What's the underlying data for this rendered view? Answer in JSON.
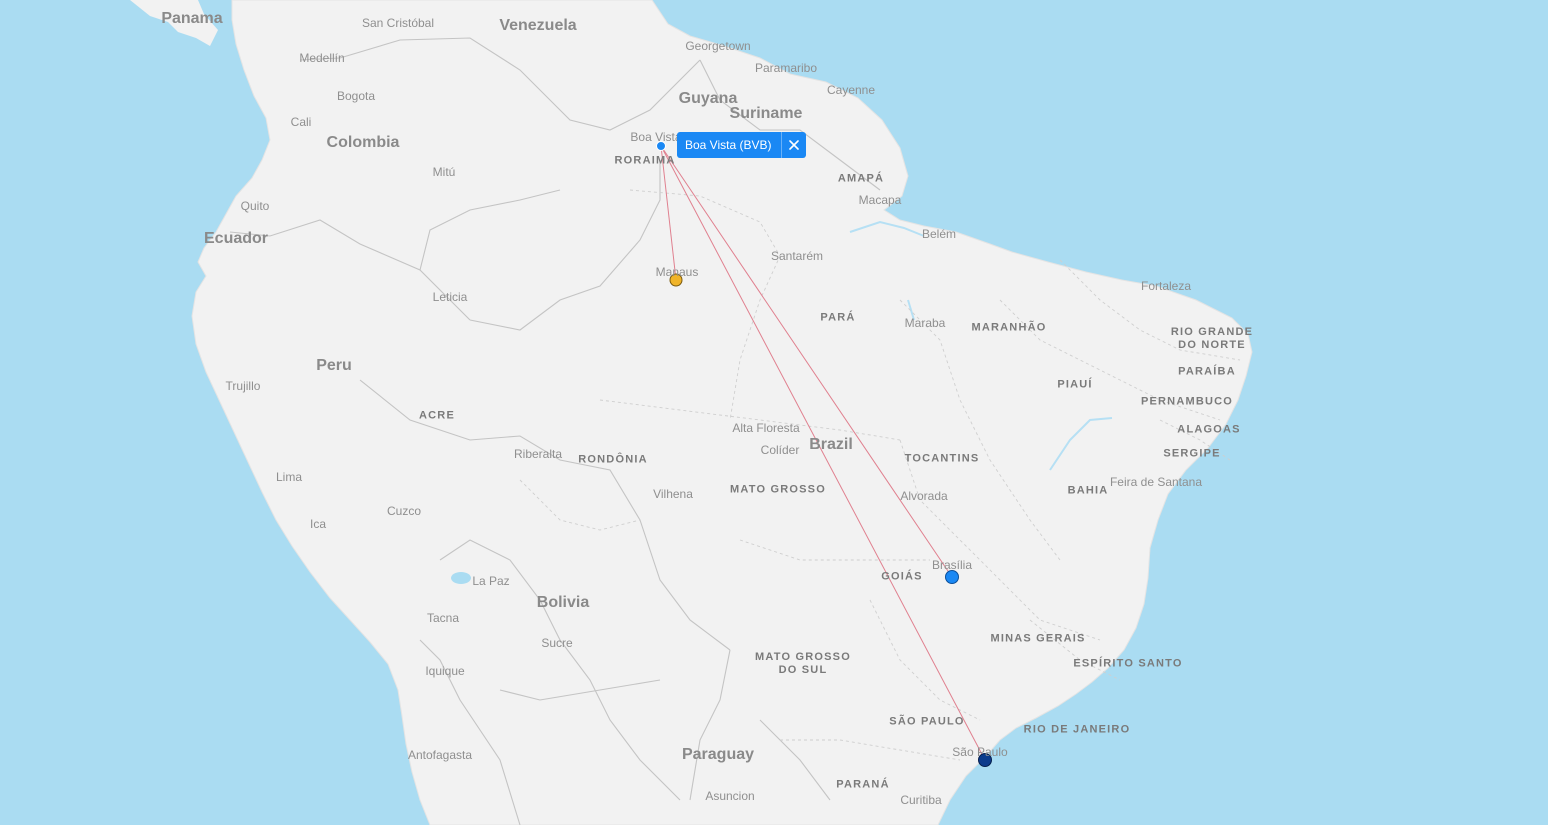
{
  "map": {
    "countries": {
      "panama": "Panama",
      "venezuela": "Venezuela",
      "guyana": "Guyana",
      "suriname": "Suriname",
      "colombia": "Colombia",
      "ecuador": "Ecuador",
      "peru": "Peru",
      "brazil": "Brazil",
      "bolivia": "Bolivia",
      "paraguay": "Paraguay"
    },
    "states": {
      "roraima": "RORAIMA",
      "amapa": "AMAPÁ",
      "para": "PARÁ",
      "maranhao": "MARANHÃO",
      "rio_grande_do_norte": "RIO GRANDE\nDO NORTE",
      "paraiba": "PARAÍBA",
      "piaui": "PIAUÍ",
      "pernambuco": "PERNAMBUCO",
      "alagoas": "ALAGOAS",
      "sergipe": "SERGIPE",
      "acre": "ACRE",
      "rondonia": "RONDÔNIA",
      "mato_grosso": "MATO GROSSO",
      "tocantins": "TOCANTINS",
      "bahia": "BAHIA",
      "goias": "GOIÁS",
      "minas_gerais": "MINAS GERAIS",
      "espirito_santo": "ESPÍRITO SANTO",
      "mato_grosso_do_sul": "MATO GROSSO\nDO SUL",
      "sao_paulo_state": "SÃO PAULO",
      "rio_de_janeiro": "RIO DE JANEIRO",
      "parana": "PARANÁ"
    },
    "cities": {
      "san_cristobal": "San Cristóbal",
      "georgetown": "Georgetown",
      "paramaribo": "Paramaribo",
      "cayenne": "Cayenne",
      "medellin": "Medellín",
      "bogota": "Bogota",
      "cali": "Cali",
      "boa_vista": "Boa Vista",
      "mitu": "Mitú",
      "macapa": "Macapa",
      "quito": "Quito",
      "belem": "Belém",
      "manaus": "Manaus",
      "santarem": "Santarém",
      "fortaleza": "Fortaleza",
      "leticia": "Leticia",
      "maraba": "Maraba",
      "trujillo": "Trujillo",
      "alta_floresta": "Alta Floresta",
      "colider": "Colíder",
      "riberalta": "Riberalta",
      "lima": "Lima",
      "vilhena": "Vilhena",
      "alvorada": "Alvorada",
      "feira_de_santana": "Feira de Santana",
      "cuzco": "Cuzco",
      "ica": "Ica",
      "brasilia": "Brasília",
      "la_paz": "La Paz",
      "tacna": "Tacna",
      "sucre": "Sucre",
      "iquique": "Iquique",
      "antofagasta": "Antofagasta",
      "sao_paulo": "São Paulo",
      "asuncion": "Asuncion",
      "curitiba": "Curitiba"
    },
    "markers": {
      "origin_color": "#1a88f4",
      "manaus_color": "#f0b429",
      "brasilia_color": "#1a88f4",
      "sao_paulo_color": "#0d3b8c",
      "route_color": "#e0808f"
    },
    "tooltip": {
      "label": "Boa Vista (BVB)",
      "close_icon": "close-icon"
    }
  }
}
